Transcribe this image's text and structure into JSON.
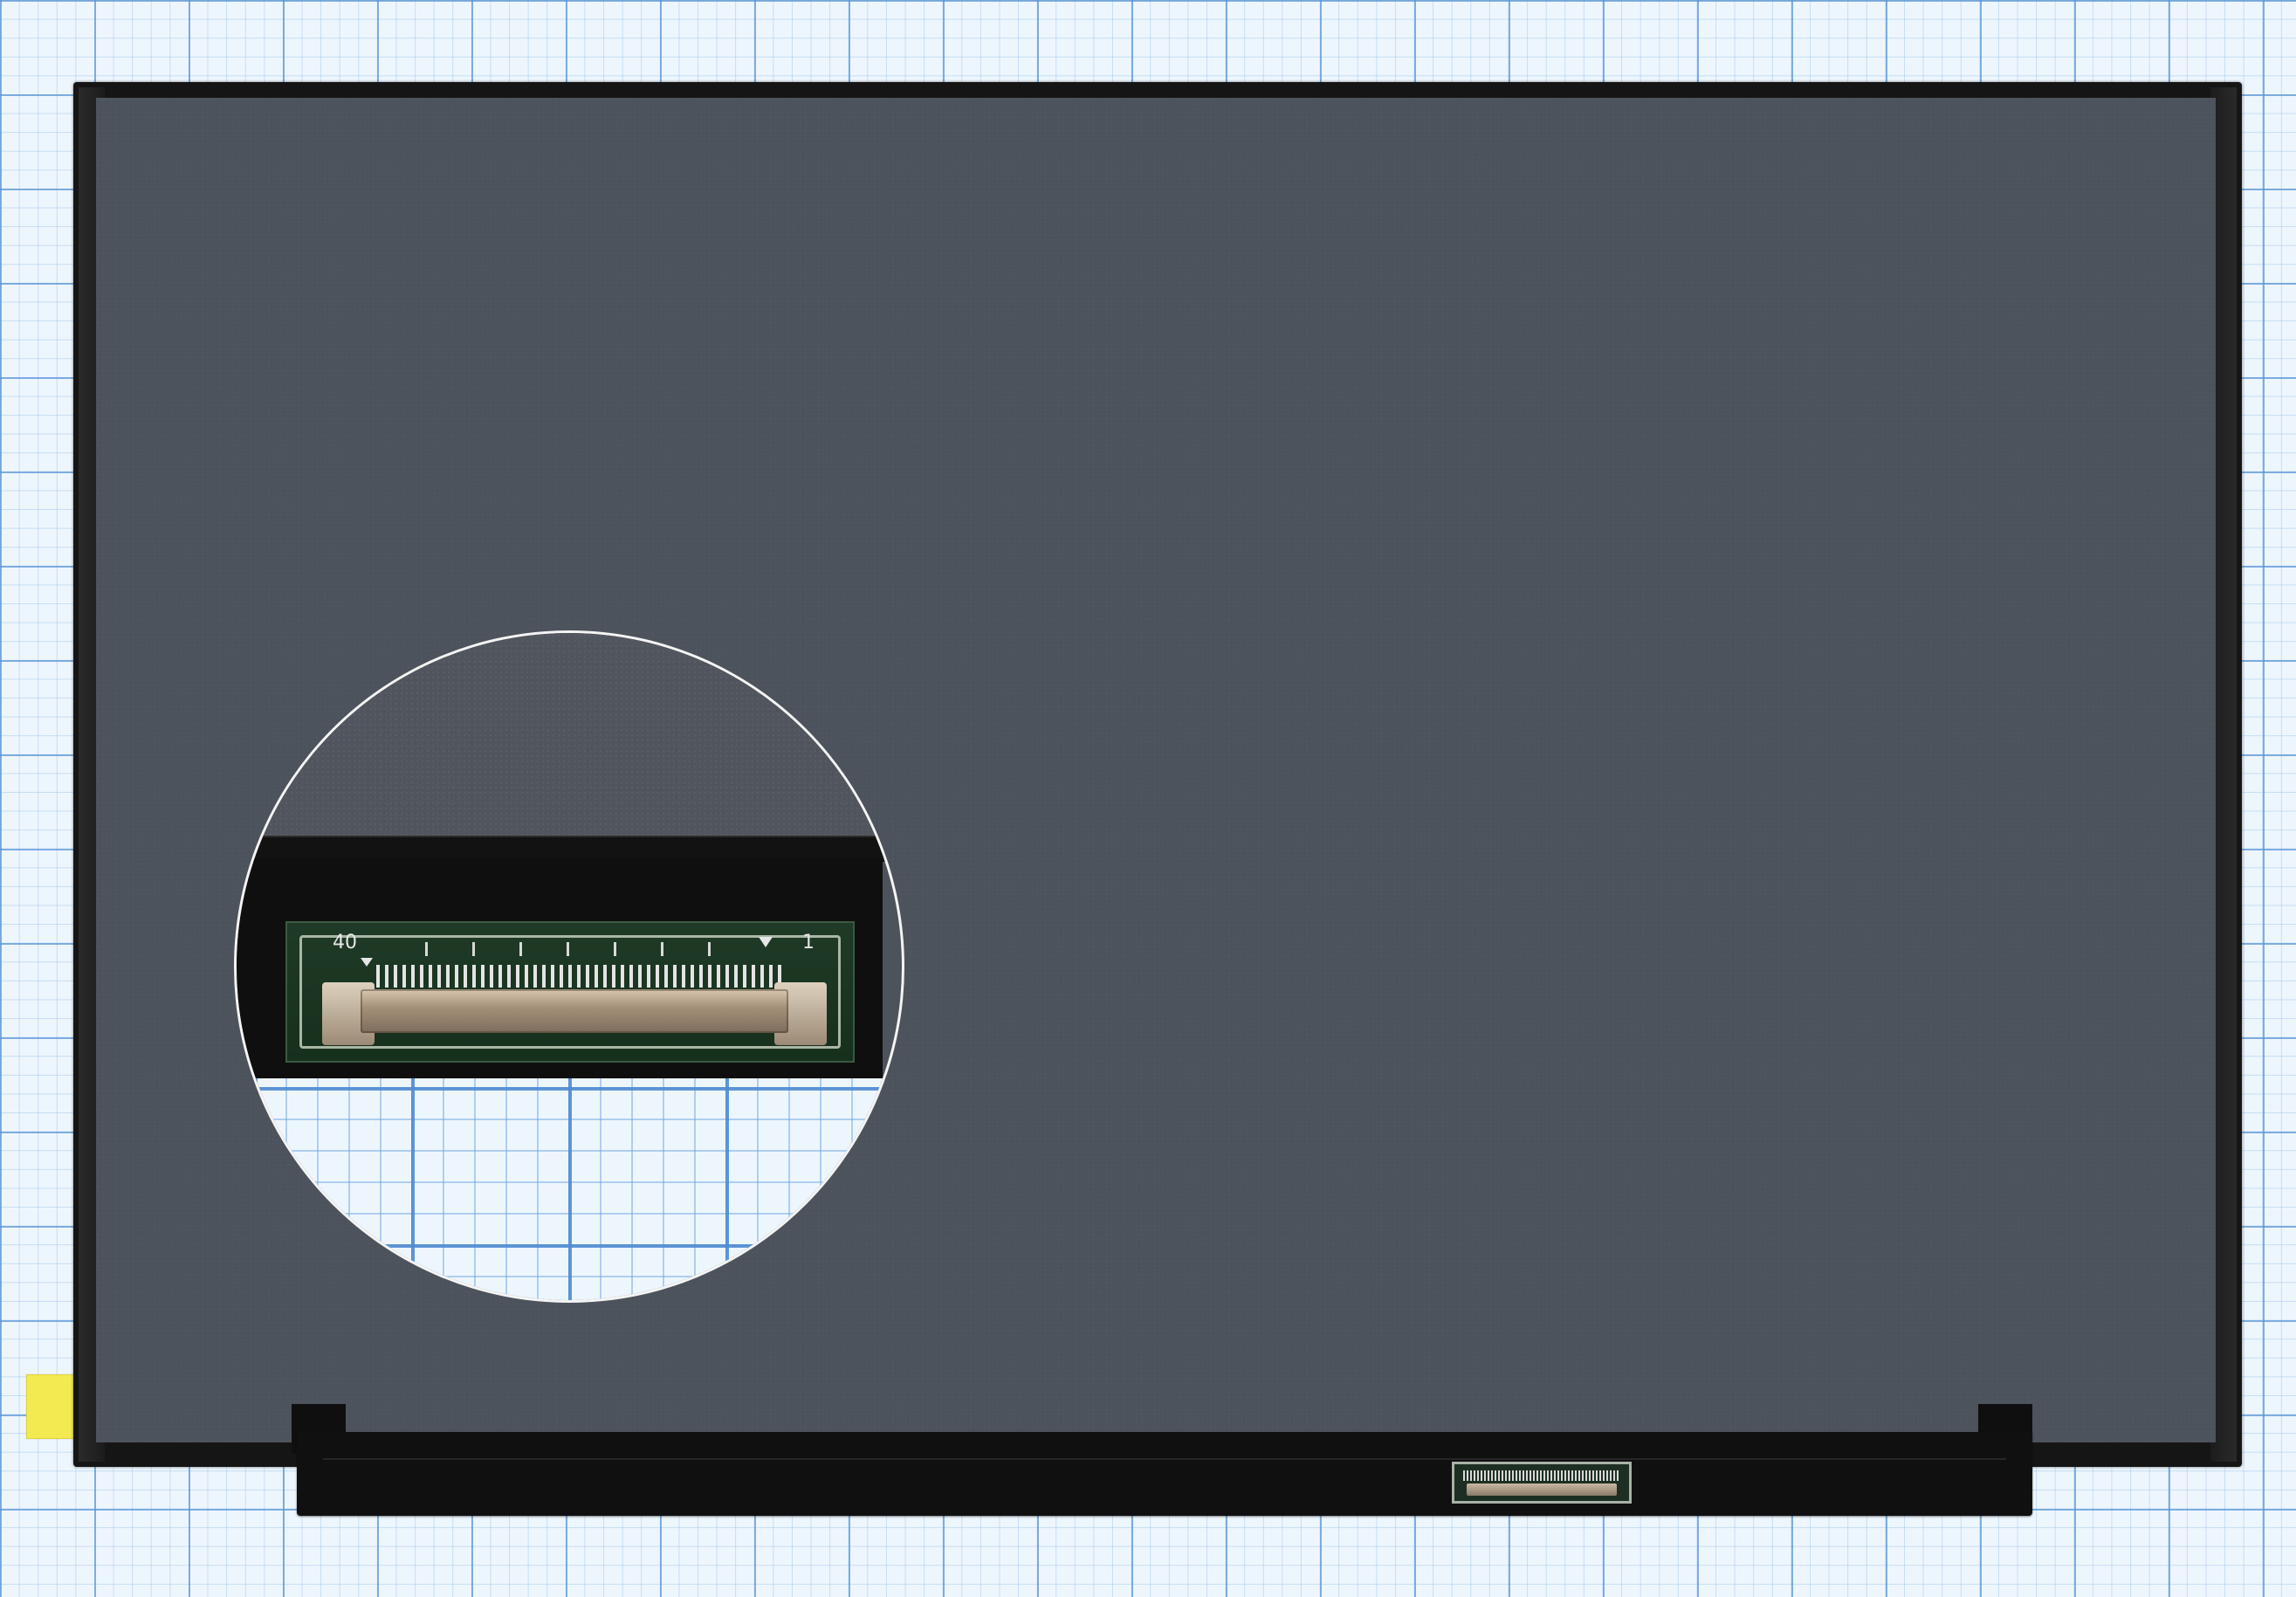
{
  "photo": {
    "subject": "laptop-lcd-panel",
    "background": "graph-paper",
    "colors": {
      "screen": "#4d535c",
      "bezel": "#151515",
      "tape": "#f3ea52",
      "grid_line": "#5a96d7",
      "pcb": "#1f3a26"
    }
  },
  "connector_zoom": {
    "pin_label_left": "40",
    "pin_label_right": "1"
  }
}
